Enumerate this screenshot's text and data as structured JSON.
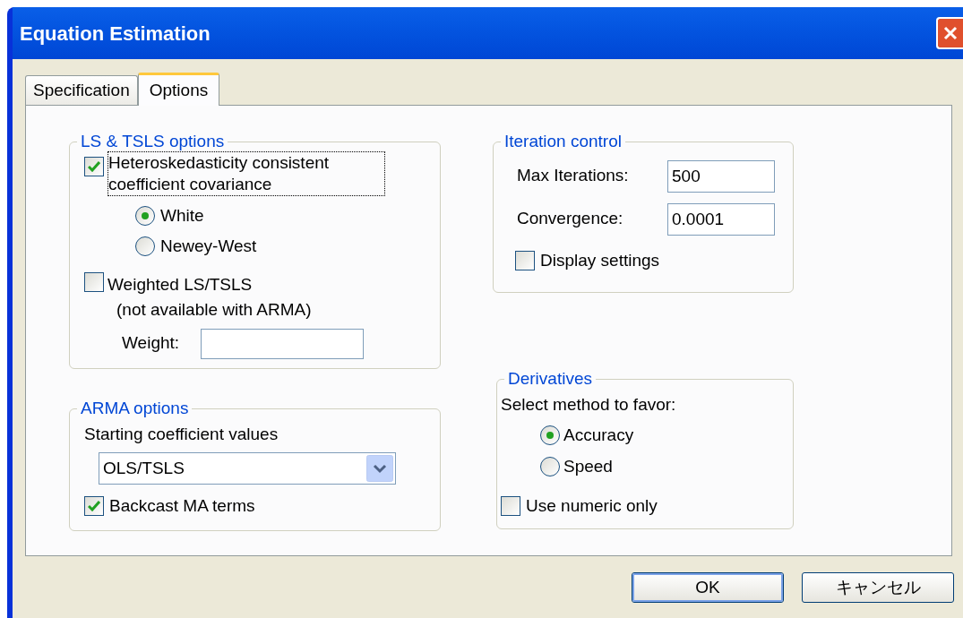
{
  "window": {
    "title": "Equation Estimation"
  },
  "tabs": [
    {
      "label": "Specification",
      "selected": false
    },
    {
      "label": "Options",
      "selected": true
    }
  ],
  "ls_tsls_options": {
    "title": "LS & TSLS options",
    "heteroskedasticity": {
      "label": "Heteroskedasticity consistent coefficient covariance",
      "checked": true
    },
    "covariance_methods": [
      {
        "label": "White",
        "selected": true
      },
      {
        "label": "Newey-West",
        "selected": false
      }
    ],
    "weighted": {
      "label": "Weighted LS/TSLS",
      "note": "(not available with ARMA)",
      "checked": false
    },
    "weight": {
      "label": "Weight:"
    }
  },
  "arma_options": {
    "title": "ARMA options",
    "starting_label": "Starting coefficient values",
    "starting_value": "OLS/TSLS",
    "backcast": {
      "label": "Backcast MA terms",
      "checked": true
    }
  },
  "iteration_control": {
    "title": "Iteration control",
    "fields": [
      {
        "label": "Max Iterations:",
        "value": "500"
      },
      {
        "label": "Convergence:",
        "value": "0.0001"
      }
    ],
    "display_settings": {
      "label": "Display settings",
      "checked": false
    }
  },
  "derivatives": {
    "title": "Derivatives",
    "prompt": "Select method to favor:",
    "methods": [
      {
        "label": "Accuracy",
        "selected": true
      },
      {
        "label": "Speed",
        "selected": false
      }
    ],
    "numeric_only": {
      "label": "Use numeric only",
      "checked": false
    }
  },
  "buttons": [
    "OK",
    "キャンセル"
  ]
}
